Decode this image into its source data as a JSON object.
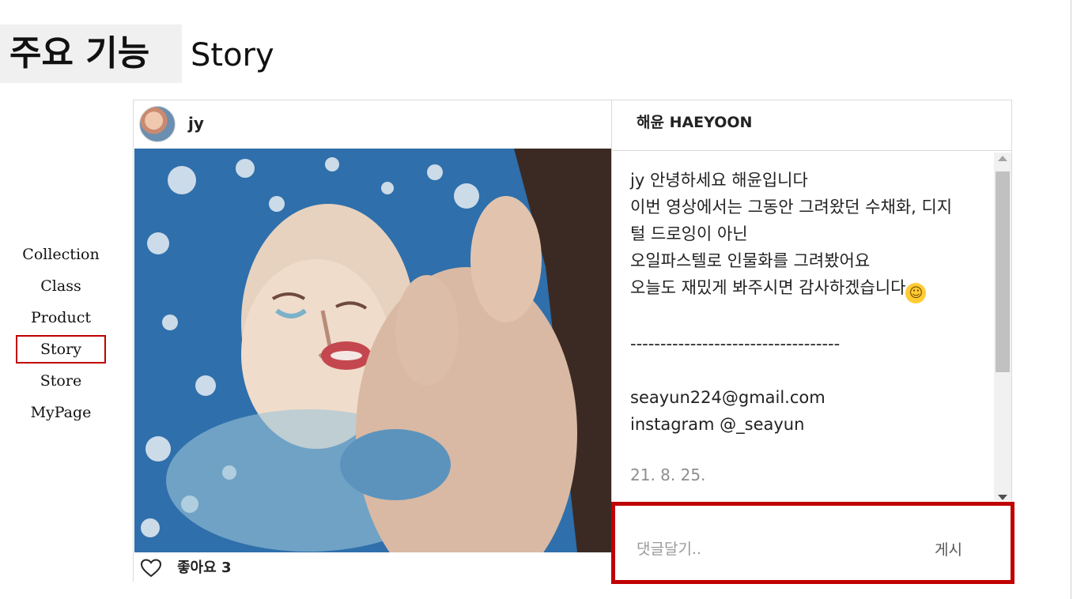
{
  "title": {
    "main": "주요 기능",
    "sub": "Story"
  },
  "menu": {
    "items": [
      {
        "label": "Collection"
      },
      {
        "label": "Class"
      },
      {
        "label": "Product"
      },
      {
        "label": "Story"
      },
      {
        "label": "Store"
      },
      {
        "label": "MyPage"
      }
    ],
    "active": "Story"
  },
  "post": {
    "username": "jy",
    "likes_label": "좋아요 3",
    "channel_title": "해윤 HAEYOON",
    "description": {
      "lines": [
        "jy 안녕하세요 해윤입니다",
        "이번 영상에서는 그동안 그려왔던 수채화, 디지",
        "털 드로잉이 아닌",
        "오일파스텔로 인물화를 그려봤어요",
        "오늘도 재밌게 봐주시면 감사하겠습니다"
      ],
      "divider": "-----------------------------------",
      "email": "seayun224@gmail.com",
      "instagram": "instagram @_seayun",
      "date": "21. 8. 25."
    }
  },
  "comment": {
    "placeholder": "댓글달기..",
    "post_label": "게시"
  },
  "colors": {
    "highlight": "#c00000",
    "border": "#dbdbdb"
  },
  "icons": [
    "heart-icon",
    "smile-emoji-icon",
    "avatar"
  ]
}
